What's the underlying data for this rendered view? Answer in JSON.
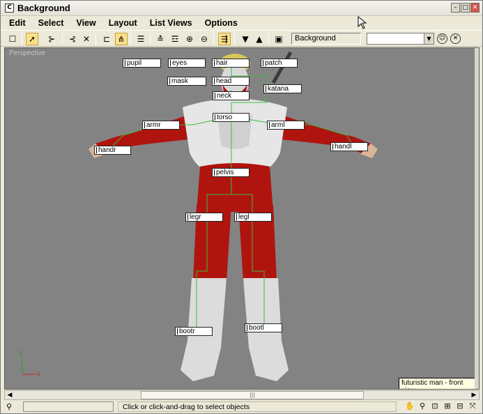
{
  "window": {
    "title": "Background",
    "app_icon": "C"
  },
  "menu": [
    "Edit",
    "Select",
    "View",
    "Layout",
    "List Views",
    "Options"
  ],
  "toolbar": {
    "background_field": "Background",
    "select_value": ""
  },
  "viewport": {
    "label": "Perspective",
    "tooltip": "futuristic man - front view",
    "axis": {
      "z": "z",
      "x": "x"
    }
  },
  "bones": {
    "pupil": "pupil",
    "eyes": "eyes",
    "hair": "hair",
    "patch": "patch",
    "mask": "mask",
    "head": "head",
    "katana": "katana",
    "neck": "neck",
    "torso": "torso",
    "armr": "armr",
    "arml": "arml",
    "handr": "handr",
    "handl": "handl",
    "pelvis": "pelvis",
    "legr": "legr",
    "legl": "legl",
    "bootr": "bootr",
    "bootl": "bootl"
  },
  "statusbar": {
    "text": "Click or click-and-drag to select objects"
  },
  "colors": {
    "viewport_bg": "#838383",
    "suit_red": "#b0140f",
    "suit_white": "#e6e6e6",
    "link_green": "#3cbd3c"
  }
}
